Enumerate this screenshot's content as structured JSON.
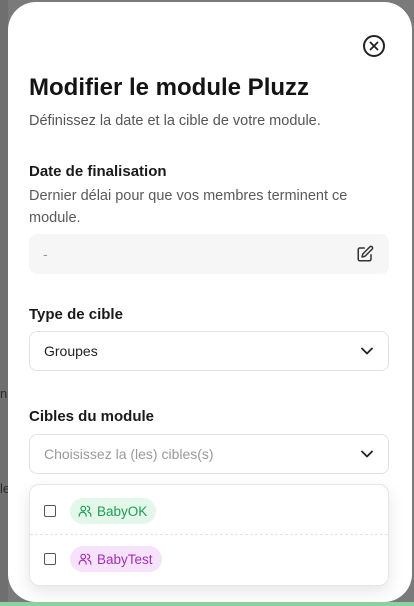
{
  "modal": {
    "title": "Modifier le module Pluzz",
    "subtitle": "Définissez la date et la cible de votre module."
  },
  "deadline": {
    "label": "Date de finalisation",
    "help": "Dernier délai pour que vos membres terminent ce module.",
    "value": "-"
  },
  "target_type": {
    "label": "Type de cible",
    "selected": "Groupes"
  },
  "targets": {
    "label": "Cibles du module",
    "placeholder": "Choisissez la (les) cibles(s)",
    "options": [
      {
        "label": "BabyOK",
        "checked": false,
        "color": "#1f9d55",
        "bg": "#e3f7ea"
      },
      {
        "label": "BabyTest",
        "checked": false,
        "color": "#a12fb8",
        "bg": "#f7e2fb"
      }
    ]
  },
  "backdrop": {
    "fragment_1": "n",
    "fragment_2": "le"
  },
  "icons": {
    "close": "close-circle-icon",
    "edit": "edit-icon",
    "chevron": "chevron-down-icon",
    "group": "users-icon"
  }
}
